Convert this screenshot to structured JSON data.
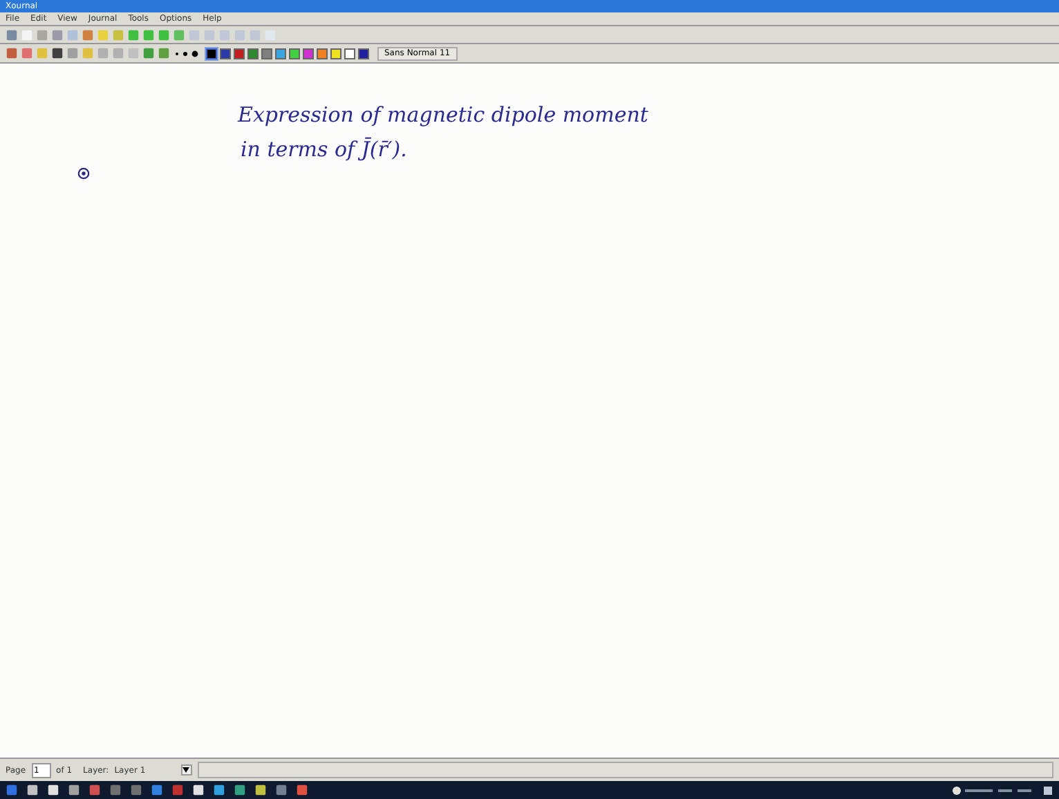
{
  "window": {
    "title": "Xournal"
  },
  "menu": [
    "File",
    "Edit",
    "View",
    "Journal",
    "Tools",
    "Options",
    "Help"
  ],
  "toolbar_colors": [
    {
      "color": "#000000",
      "selected": true
    },
    {
      "color": "#2a3aa8",
      "selected": false
    },
    {
      "color": "#c41d1d",
      "selected": false
    },
    {
      "color": "#2d8a2d",
      "selected": false
    },
    {
      "color": "#808080",
      "selected": false
    },
    {
      "color": "#3aa6e0",
      "selected": false
    },
    {
      "color": "#40d040",
      "selected": false
    },
    {
      "color": "#d030d0",
      "selected": false
    },
    {
      "color": "#f08020",
      "selected": false
    },
    {
      "color": "#f0e020",
      "selected": false
    },
    {
      "color": "#ffffff",
      "selected": false
    },
    {
      "color": "#2020a0",
      "selected": false
    }
  ],
  "font_button": "Sans Normal 11",
  "page": {
    "lines": [
      "Expression of magnetic dipole moment",
      "in terms of J̄(r̄′)."
    ]
  },
  "status_bar": {
    "page_label": "Page",
    "page_value": "1",
    "page_of": "of 1",
    "layer_label": "Layer:",
    "layer_value": "Layer 1"
  }
}
